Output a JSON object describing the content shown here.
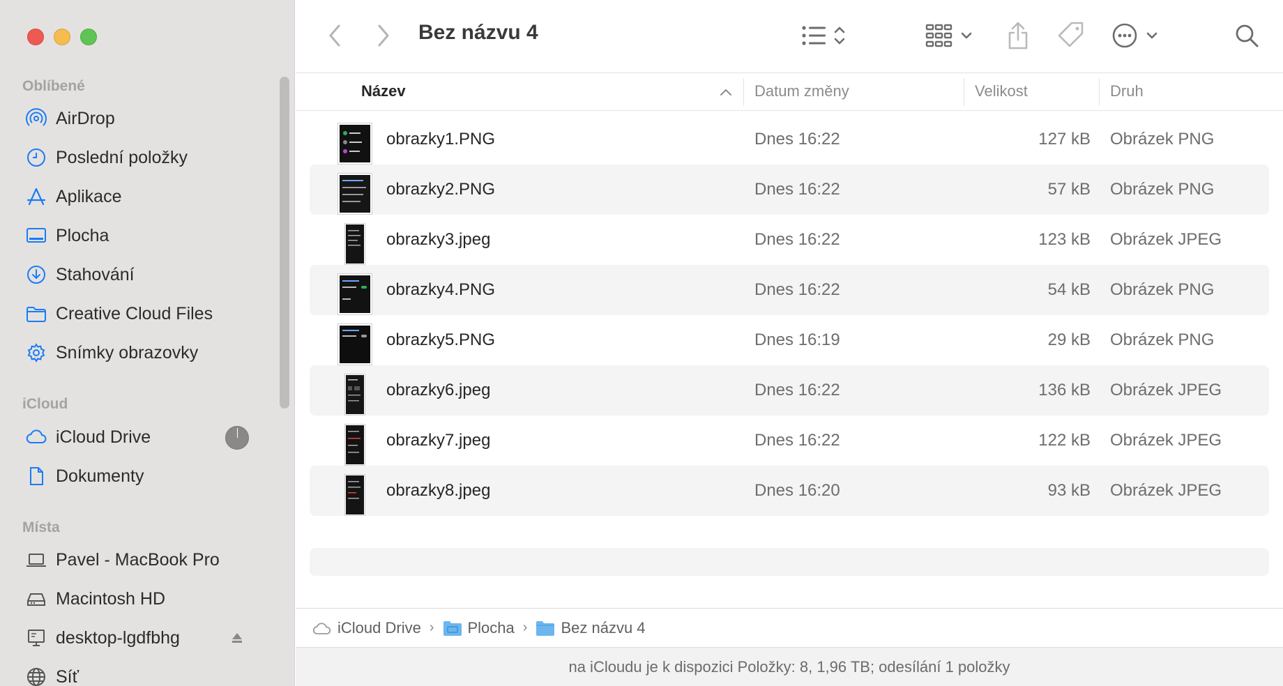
{
  "window": {
    "title": "Bez názvu 4"
  },
  "sidebar": {
    "sections": [
      {
        "label": "Oblíbené",
        "items": [
          {
            "label": "AirDrop",
            "icon": "airdrop-icon"
          },
          {
            "label": "Poslední položky",
            "icon": "clock-icon"
          },
          {
            "label": "Aplikace",
            "icon": "applications-icon"
          },
          {
            "label": "Plocha",
            "icon": "desktop-icon"
          },
          {
            "label": "Stahování",
            "icon": "download-icon"
          },
          {
            "label": "Creative Cloud Files",
            "icon": "folder-icon"
          },
          {
            "label": "Snímky obrazovky",
            "icon": "gear-icon"
          }
        ]
      },
      {
        "label": "iCloud",
        "items": [
          {
            "label": "iCloud Drive",
            "icon": "cloud-icon"
          },
          {
            "label": "Dokumenty",
            "icon": "document-icon"
          }
        ]
      },
      {
        "label": "Místa",
        "items": [
          {
            "label": "Pavel - MacBook Pro",
            "icon": "laptop-icon"
          },
          {
            "label": "Macintosh HD",
            "icon": "harddisk-icon"
          },
          {
            "label": "desktop-lgdfbhg",
            "icon": "network-computer-icon"
          },
          {
            "label": "Síť",
            "icon": "globe-icon"
          }
        ]
      }
    ]
  },
  "columns": {
    "name": "Název",
    "date": "Datum změny",
    "size": "Velikost",
    "kind": "Druh"
  },
  "files": [
    {
      "name": "obrazky1.PNG",
      "date": "Dnes 16:22",
      "size": "127 kB",
      "kind": "Obrázek PNG"
    },
    {
      "name": "obrazky2.PNG",
      "date": "Dnes 16:22",
      "size": "57 kB",
      "kind": "Obrázek PNG"
    },
    {
      "name": "obrazky3.jpeg",
      "date": "Dnes 16:22",
      "size": "123 kB",
      "kind": "Obrázek JPEG"
    },
    {
      "name": "obrazky4.PNG",
      "date": "Dnes 16:22",
      "size": "54 kB",
      "kind": "Obrázek PNG"
    },
    {
      "name": "obrazky5.PNG",
      "date": "Dnes 16:19",
      "size": "29 kB",
      "kind": "Obrázek PNG"
    },
    {
      "name": "obrazky6.jpeg",
      "date": "Dnes 16:22",
      "size": "136 kB",
      "kind": "Obrázek JPEG"
    },
    {
      "name": "obrazky7.jpeg",
      "date": "Dnes 16:22",
      "size": "122 kB",
      "kind": "Obrázek JPEG"
    },
    {
      "name": "obrazky8.jpeg",
      "date": "Dnes 16:20",
      "size": "93 kB",
      "kind": "Obrázek JPEG"
    }
  ],
  "pathbar": [
    "iCloud Drive",
    "Plocha",
    "Bez názvu 4"
  ],
  "status": "na iCloudu je k dispozici Položky: 8, 1,96 TB; odesílání 1 položky",
  "colors": {
    "accent": "#1a7cf5",
    "sidebar_bg": "#e4e2e1"
  }
}
